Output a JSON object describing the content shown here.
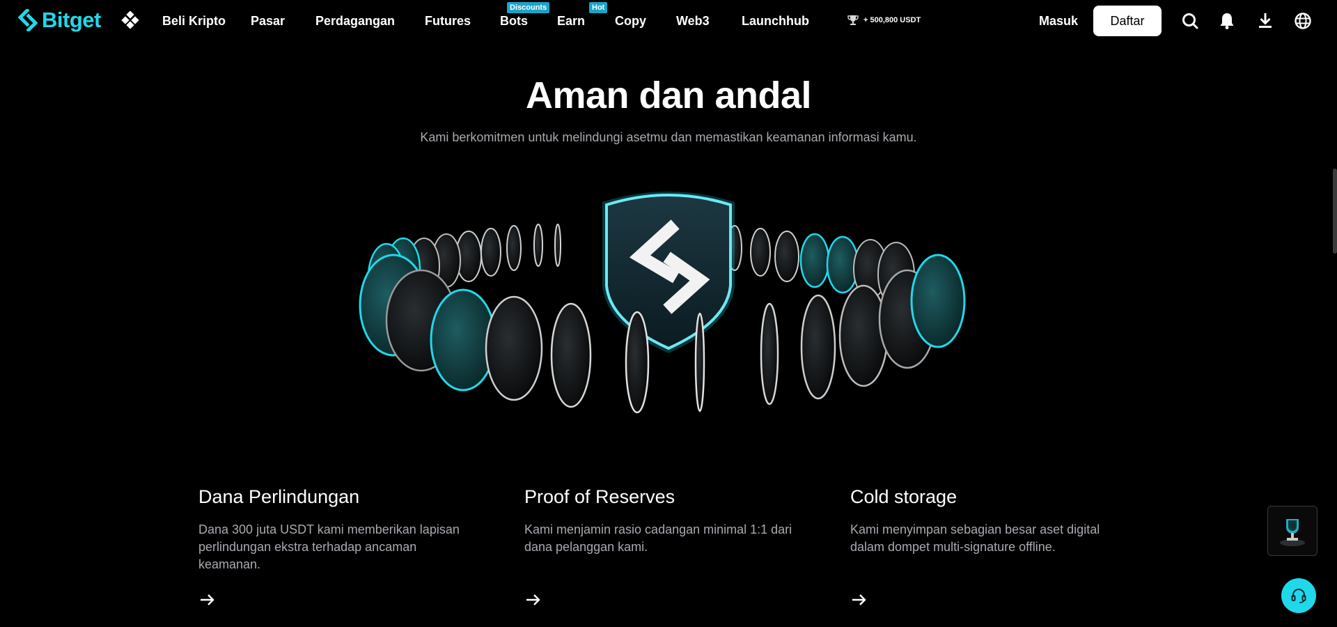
{
  "header": {
    "logo_text": "Bitget",
    "nav": [
      {
        "label": "Beli Kripto"
      },
      {
        "label": "Pasar"
      },
      {
        "label": "Perdagangan"
      },
      {
        "label": "Futures"
      },
      {
        "label": "Bots",
        "badge": "Discounts"
      },
      {
        "label": "Earn",
        "badge": "Hot"
      },
      {
        "label": "Copy"
      },
      {
        "label": "Web3"
      },
      {
        "label": "Launchhub"
      }
    ],
    "promo": "+ 500,800 USDT",
    "login_label": "Masuk",
    "signup_label": "Daftar",
    "icons": [
      "search-icon",
      "bell-icon",
      "download-icon",
      "globe-icon"
    ]
  },
  "hero": {
    "title": "Aman dan andal",
    "subtitle": "Kami berkomitmen untuk melindungi asetmu dan memastikan keamanan informasi kamu."
  },
  "features": [
    {
      "title": "Dana Perlindungan",
      "description": "Dana 300 juta USDT kami memberikan lapisan perlindungan ekstra terhadap ancaman keamanan."
    },
    {
      "title": "Proof of Reserves",
      "description": "Kami menjamin rasio cadangan minimal 1:1 dari dana pelanggan kami."
    },
    {
      "title": "Cold storage",
      "description": "Kami menyimpan sebagian besar aset digital dalam dompet multi-signature offline."
    }
  ],
  "colors": {
    "accent": "#1fd9ea",
    "background": "#000000",
    "muted_text": "#a9a9b1",
    "badge": "#1ba4c9"
  }
}
